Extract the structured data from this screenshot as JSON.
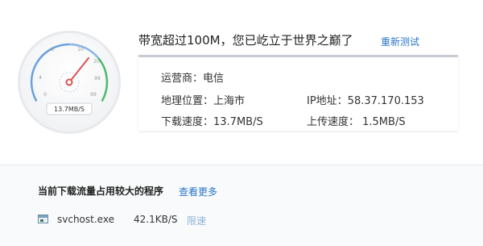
{
  "gauge": {
    "ticks": [
      "0",
      "4",
      "8",
      "10",
      "20",
      "99",
      "99"
    ],
    "readout": "13.7MB/S",
    "needle_value": "13.7"
  },
  "header": {
    "headline": "带宽超过100M，您已屹立于世界之巅了",
    "retest_label": "重新测试"
  },
  "info": {
    "isp": "运营商：电信",
    "location": "地理位置：上海市",
    "ip": "IP地址：58.37.170.153",
    "download": "下载速度：13.7MB/S",
    "upload": "上传速度：  1.5MB/S"
  },
  "programs": {
    "title": "当前下载流量占用较大的程序",
    "view_more": "查看更多",
    "items": [
      {
        "icon": "program-window-icon",
        "name": "svchost.exe",
        "speed": "42.1KB/S",
        "action": "限速"
      }
    ]
  },
  "colors": {
    "accent": "#2a75c7",
    "needle": "#d9534f",
    "gauge_scale": "#6aa0e0",
    "gauge_high": "#4cb86a"
  }
}
